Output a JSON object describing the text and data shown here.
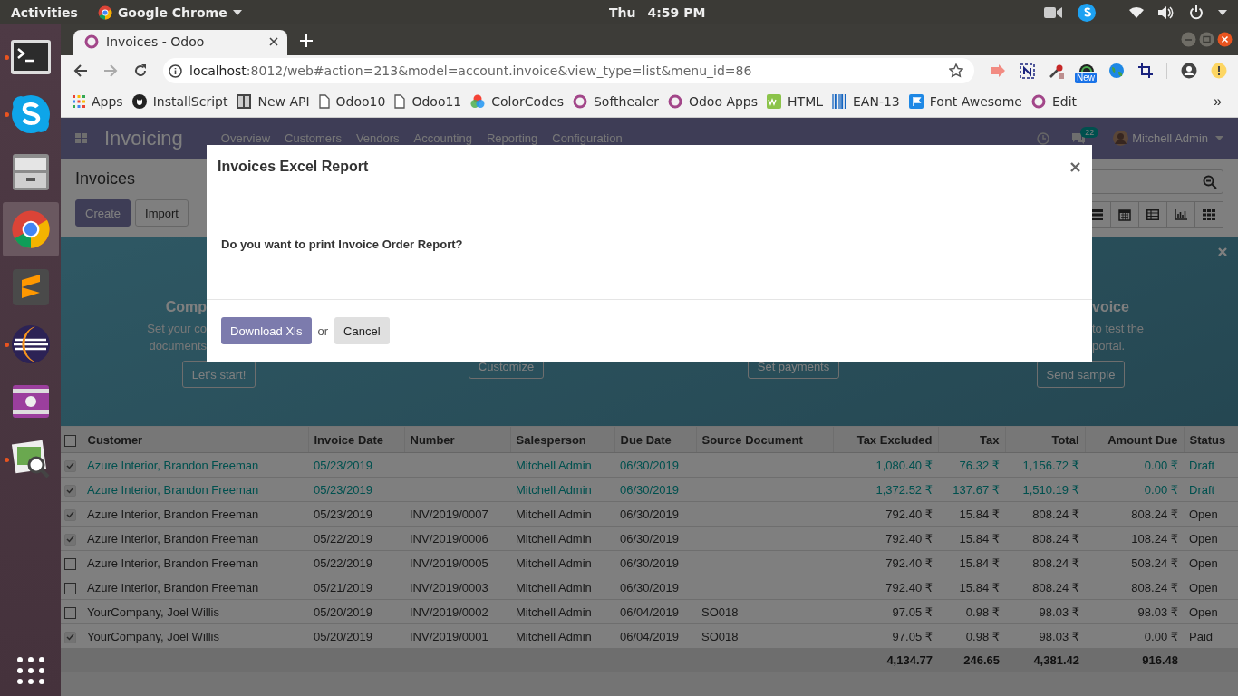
{
  "desktop_bar": {
    "activities": "Activities",
    "app_menu": "Google Chrome",
    "day": "Thu",
    "time": "4:59 PM"
  },
  "dock": {
    "apps": [
      {
        "kind": "terminal",
        "running": true,
        "selected": false
      },
      {
        "kind": "skype",
        "running": true,
        "selected": false
      },
      {
        "kind": "files",
        "running": false,
        "selected": false
      },
      {
        "kind": "chrome",
        "running": false,
        "selected": true
      },
      {
        "kind": "sublime",
        "running": false,
        "selected": false
      },
      {
        "kind": "eclipse",
        "running": true,
        "selected": false
      },
      {
        "kind": "video",
        "running": false,
        "selected": false
      },
      {
        "kind": "viewer",
        "running": true,
        "selected": false
      }
    ]
  },
  "browser": {
    "tab_title": "Invoices - Odoo",
    "url_host": "localhost",
    "url_rest": ":8012/web#action=213&model=account.invoice&view_type=list&menu_id=86",
    "extension_badge": "New",
    "bookmarks": [
      {
        "kind": "apps",
        "label": "Apps"
      },
      {
        "kind": "github",
        "label": "InstallScript"
      },
      {
        "kind": "book",
        "label": "New API"
      },
      {
        "kind": "page",
        "label": "Odoo10"
      },
      {
        "kind": "page",
        "label": "Odoo11"
      },
      {
        "kind": "colors",
        "label": "ColorCodes"
      },
      {
        "kind": "odoo",
        "label": "Softhealer"
      },
      {
        "kind": "odoo",
        "label": "Odoo Apps"
      },
      {
        "kind": "w3",
        "label": "HTML"
      },
      {
        "kind": "barcode",
        "label": "EAN-13"
      },
      {
        "kind": "flag",
        "label": "Font Awesome"
      },
      {
        "kind": "odoo",
        "label": "Edit"
      }
    ],
    "more": "»"
  },
  "odoo": {
    "app": "Invoicing",
    "menu": [
      "Overview",
      "Customers",
      "Vendors",
      "Accounting",
      "Reporting",
      "Configuration"
    ],
    "messages_count": "22",
    "user": "Mitchell Admin",
    "title": "Invoices",
    "buttons": [
      {
        "label": "Create",
        "kind": "primary"
      },
      {
        "label": "Import",
        "kind": "secondary"
      }
    ],
    "views": [
      {
        "kind": "list"
      },
      {
        "kind": "calendar"
      },
      {
        "kind": "pivot"
      },
      {
        "kind": "graph"
      },
      {
        "kind": "grid"
      }
    ],
    "banner": [
      {
        "kind": "left",
        "heading": "Comp",
        "lines": [
          "Set your co",
          "documents"
        ],
        "button": "Let's start!"
      },
      {
        "kind": "middle",
        "button": "Customize"
      },
      {
        "kind": "middle",
        "button": "Set payments"
      },
      {
        "kind": "right",
        "heading": "voice",
        "lines": [
          "to test the",
          "portal."
        ],
        "button": "Send sample"
      }
    ],
    "table": {
      "all_selected": false,
      "columns": [
        {
          "label": "Customer",
          "numeric": false
        },
        {
          "label": "Invoice Date",
          "numeric": false
        },
        {
          "label": "Number",
          "numeric": false
        },
        {
          "label": "Salesperson",
          "numeric": false
        },
        {
          "label": "Due Date",
          "numeric": false
        },
        {
          "label": "Source Document",
          "numeric": false
        },
        {
          "label": "Tax Excluded",
          "numeric": true,
          "total": "4,134.77"
        },
        {
          "label": "Tax",
          "numeric": true,
          "total": "246.65"
        },
        {
          "label": "Total",
          "numeric": true,
          "total": "4,381.42"
        },
        {
          "label": "Amount Due",
          "numeric": true,
          "total": "916.48"
        },
        {
          "label": "Status",
          "numeric": false
        }
      ],
      "rows": [
        {
          "selected": true,
          "kind": "draft",
          "cells": [
            "Azure Interior, Brandon Freeman",
            "05/23/2019",
            null,
            "Mitchell Admin",
            "06/30/2019",
            null,
            "1,080.40 ₹",
            "76.32 ₹",
            "1,156.72 ₹",
            "0.00 ₹",
            "Draft"
          ]
        },
        {
          "selected": true,
          "kind": "draft",
          "cells": [
            "Azure Interior, Brandon Freeman",
            "05/23/2019",
            null,
            "Mitchell Admin",
            "06/30/2019",
            null,
            "1,372.52 ₹",
            "137.67 ₹",
            "1,510.19 ₹",
            "0.00 ₹",
            "Draft"
          ]
        },
        {
          "selected": true,
          "kind": "posted",
          "cells": [
            "Azure Interior, Brandon Freeman",
            "05/23/2019",
            "INV/2019/0007",
            "Mitchell Admin",
            "06/30/2019",
            null,
            "792.40 ₹",
            "15.84 ₹",
            "808.24 ₹",
            "808.24 ₹",
            "Open"
          ]
        },
        {
          "selected": true,
          "kind": "posted",
          "cells": [
            "Azure Interior, Brandon Freeman",
            "05/22/2019",
            "INV/2019/0006",
            "Mitchell Admin",
            "06/30/2019",
            null,
            "792.40 ₹",
            "15.84 ₹",
            "808.24 ₹",
            "108.24 ₹",
            "Open"
          ]
        },
        {
          "selected": false,
          "kind": "posted",
          "cells": [
            "Azure Interior, Brandon Freeman",
            "05/22/2019",
            "INV/2019/0005",
            "Mitchell Admin",
            "06/30/2019",
            null,
            "792.40 ₹",
            "15.84 ₹",
            "808.24 ₹",
            "508.24 ₹",
            "Open"
          ]
        },
        {
          "selected": false,
          "kind": "posted",
          "cells": [
            "Azure Interior, Brandon Freeman",
            "05/21/2019",
            "INV/2019/0003",
            "Mitchell Admin",
            "06/30/2019",
            null,
            "792.40 ₹",
            "15.84 ₹",
            "808.24 ₹",
            "808.24 ₹",
            "Open"
          ]
        },
        {
          "selected": false,
          "kind": "posted",
          "cells": [
            "YourCompany, Joel Willis",
            "05/20/2019",
            "INV/2019/0002",
            "Mitchell Admin",
            "06/04/2019",
            "SO018",
            "97.05 ₹",
            "0.98 ₹",
            "98.03 ₹",
            "98.03 ₹",
            "Open"
          ]
        },
        {
          "selected": true,
          "kind": "posted",
          "cells": [
            "YourCompany, Joel Willis",
            "05/20/2019",
            "INV/2019/0001",
            "Mitchell Admin",
            "06/04/2019",
            "SO018",
            "97.05 ₹",
            "0.98 ₹",
            "98.03 ₹",
            "0.00 ₹",
            "Paid"
          ]
        }
      ]
    }
  },
  "dialog": {
    "title": "Invoices Excel Report",
    "message": "Do you want to print Invoice Order Report?",
    "primary": "Download Xls",
    "separator": "or",
    "secondary": "Cancel"
  }
}
